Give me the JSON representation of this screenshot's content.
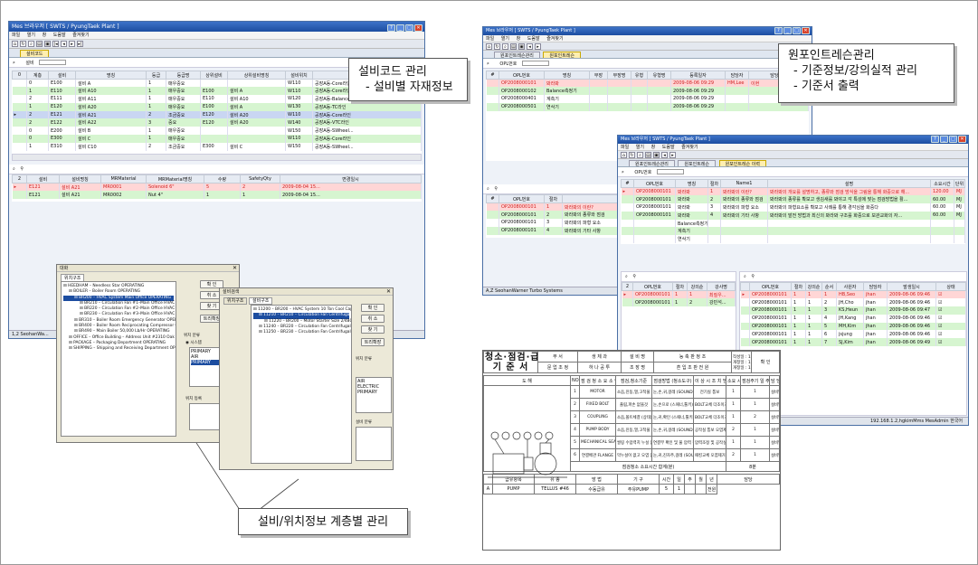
{
  "win1": {
    "title": "Mes 브라우저 [ SWTS / PyungTaek Plant ]",
    "menu": [
      "파일",
      "열기",
      "창",
      "도움말",
      "즐겨찾기"
    ],
    "tab": "설비코드",
    "search_label": "설비",
    "columns": [
      "0",
      "계층",
      "설비",
      "명칭",
      "등급",
      "등급명",
      "상위설비",
      "상위설비명칭",
      "설비위치",
      "위치명칭"
    ],
    "rows": [
      [
        "",
        "0",
        "E100",
        "설비 A",
        "1",
        "매우중요",
        "",
        "",
        "W110",
        "공장A동-Core라인"
      ],
      [
        "",
        "1",
        "E110",
        "설비 A10",
        "1",
        "매우중요",
        "E100",
        "설비 A",
        "W110",
        "공장A동-Core라인"
      ],
      [
        "",
        "2",
        "E111",
        "설비 A11",
        "1",
        "매우중요",
        "E110",
        "설비 A10",
        "W120",
        "공장A동-Balance..."
      ],
      [
        "",
        "1",
        "E120",
        "설비 A20",
        "1",
        "매우중요",
        "E100",
        "설비 A",
        "W130",
        "공장A동-TC라인"
      ],
      [
        "▸",
        "2",
        "E121",
        "설비 A21",
        "2",
        "조금중요",
        "E120",
        "설비 A20",
        "W110",
        "공장A동-Core라인"
      ],
      [
        "",
        "2",
        "E122",
        "설비 A22",
        "3",
        "중요",
        "E120",
        "설비 A20",
        "W140",
        "공장A동-VTC라인"
      ],
      [
        "",
        "0",
        "E200",
        "설비 B",
        "1",
        "매우중요",
        "",
        "",
        "W150",
        "공장A동-SWheel..."
      ],
      [
        "",
        "0",
        "E300",
        "설비 C",
        "1",
        "매우중요",
        "",
        "",
        "W110",
        "공장A동-Core라인"
      ],
      [
        "",
        "1",
        "E310",
        "설비 C10",
        "2",
        "조금중요",
        "E300",
        "설비 C",
        "W150",
        "공장A동-SWheel..."
      ]
    ],
    "sub_columns": [
      "2",
      "설비",
      "설비명칭",
      "MRMaterial",
      "MRMaterial명칭",
      "수량",
      "SafetyQty",
      "변경일시"
    ],
    "sub_rows": [
      [
        "▸",
        "E121",
        "설비 A21",
        "MR0001",
        "Solenoid 6\"",
        "5",
        "2",
        "2009-08-04 15..."
      ],
      [
        "",
        "E121",
        "설비 A21",
        "MR0002",
        "Nut 4\"",
        "1",
        "1",
        "2009-08-04 15..."
      ]
    ],
    "status": "1,2  SeohanWa..."
  },
  "callout1": {
    "line1": "설비코드 관리",
    "line2": "- 설비별 자재정보"
  },
  "callout2": {
    "line1": "원포인트레슨관리",
    "line2": "- 기준정보/강의실적 관리",
    "line3": "- 기준서 출력"
  },
  "callout3": {
    "line1": "설비/위치정보 계층별 관리"
  },
  "dialog1": {
    "title": "대화",
    "tab_label": "위치구조",
    "tree": [
      "HEEDHAM – Needless Star OPERATING",
      "BOILER – Boiler Room OPERATING",
      "BR200 – HVAC System Main Office OPERATING",
      "BR210 – Circulation Fan #1–Main Office HVAC",
      "BR220 – Circulation Fan #2–Main Office HVAC",
      "BR230 – Circulation Fan #3–Main Office HVAC",
      "BR310 – Boiler Room Emergency Generator OPEF",
      "BR400 – Boiler Room Reciprocating Compressor C",
      "BR490 – Main Boiler 50,000 Lb/Hr OPERATING",
      "OFFICE – Office Building – Address Unit #2310 Oak St. Of",
      "PACKAGE – Packaging Department OPERATING",
      "SHIPPING – Shipping and Receiving Department OPEF"
    ],
    "buttons": [
      "확 인",
      "취 소",
      "찾 기",
      "트리확장"
    ],
    "section": "위치 분류",
    "radio": "시스템",
    "list": [
      "PRIMARY",
      "AIR",
      "PRIMARY"
    ],
    "section2": "위치 등록"
  },
  "dialog2": {
    "title": "설비검색",
    "tabs": [
      "위치구조",
      "설비구조"
    ],
    "tree": [
      "11200 – BR200 – HVAC System 10 Ton Cool Cap 450000 Btu",
      "11210 – BR210 – Circulation Fan Centrifugal 20,000 C",
      "11220 – BR200 – Motor Starter Size 2/480v/3p",
      "11240 – BR220 – Circulation Fan Centrifugal 20,000 C",
      "11250 – BR230 – Circulation Fan Centrifugal 20,000 C"
    ],
    "buttons": [
      "확 인",
      "취 소",
      "찾 기",
      "트리확장"
    ],
    "section": "위치 분류",
    "list": [
      "AIR",
      "ELECTRIC",
      "PRIMARY"
    ],
    "section2": "설비 분류"
  },
  "win2": {
    "title": "Mes 브라우저 [ SWTS / PyungTaek Plant ]",
    "menu": [
      "파일",
      "열기",
      "창",
      "도움말",
      "즐겨찾기"
    ],
    "tabs": [
      "원포인트레슨관리",
      "원포인트레슨"
    ],
    "search_label": "OPL번호",
    "columns": [
      "#",
      "OPL번호",
      "명칭",
      "부장",
      "부장명",
      "유형",
      "유형명",
      "등록일자",
      "담당자",
      "담당자명"
    ],
    "rows": [
      [
        "",
        "OP2008000101",
        "봐라봐",
        "",
        "",
        "",
        "",
        "2009-08-06 09:29",
        "HM,Lee",
        "이현"
      ],
      [
        "",
        "OP2008000102",
        "Balance측정기",
        "",
        "",
        "",
        "",
        "2009-08-06 09:29",
        "",
        ""
      ],
      [
        "",
        "OP2008000401",
        "계측기",
        "",
        "",
        "",
        "",
        "2009-08-06 09:29",
        "",
        ""
      ],
      [
        "",
        "OP2008000501",
        "연삭기",
        "",
        "",
        "",
        "",
        "2009-08-06 09:29",
        "",
        ""
      ]
    ],
    "sub_columns": [
      "#",
      "OPL번호",
      "절차",
      "명칭"
    ],
    "sub_rows": [
      [
        "",
        "OP2008000101",
        "1",
        "봐라봐의 이란?"
      ],
      [
        "",
        "OP2008000101",
        "2",
        "봐라봐의 종류와 점검"
      ],
      [
        "",
        "OP2008000101",
        "3",
        "봐라봐의 파형 요소"
      ],
      [
        "",
        "OP2008000101",
        "4",
        "봐라봐의 기타 사항"
      ]
    ],
    "status": "A,Z   SeohanWarner Turbo Systems"
  },
  "win3": {
    "title": "Mes 브라우저 [ SWTS / PyungTaek Plant ]",
    "menu": [
      "파일",
      "열기",
      "창",
      "도움말",
      "즐겨찾기"
    ],
    "tabs": [
      "원포인트레슨관리",
      "원포인트레슨",
      "원포인트레슨 이력"
    ],
    "search_label": "OPL번호",
    "columns": [
      "#",
      "OPL번호",
      "명칭",
      "절차",
      "Name1",
      "설명",
      "소요시간",
      "단위"
    ],
    "rows": [
      [
        "▸",
        "OP2008000101",
        "봐라봐",
        "1",
        "봐라봐의 이란?",
        "봐라봐의 개요를 설명하고, 종류와 점검 방식을 그림을 통해 화중으로 해...",
        "120.00",
        "MJ"
      ],
      [
        "",
        "OP2008000101",
        "봐라봐",
        "2",
        "봐라봐의 종류와 점검",
        "봐라봐의 종류를 확보고 생김새를 봐야고 각 특성에 맞는 점검방법을 활...",
        "60.00",
        "MJ"
      ],
      [
        "",
        "OP2008000101",
        "봐라봐",
        "3",
        "봐라봐의 파형 요소",
        "봐라봐의 파형요소를 확보고 사례를 통해 경각심을 화중다",
        "60.00",
        "MJ"
      ],
      [
        "",
        "OP2008000101",
        "봐라봐",
        "4",
        "봐라봐의 기타 사항",
        "봐라봐의 발전 방법과 최신의 봐라봐 구조를 화중으로 보관교화의 자...",
        "60.00",
        "MJ"
      ],
      [
        "",
        "",
        "Balance측정기",
        "",
        "",
        "",
        "",
        ""
      ],
      [
        "",
        "",
        "계측기",
        "",
        "",
        "",
        "",
        ""
      ],
      [
        "",
        "",
        "연삭기",
        "",
        "",
        "",
        "",
        ""
      ]
    ],
    "sub_columns": [
      "2",
      "OPL번호",
      "절차",
      "강의순",
      "강사명"
    ],
    "sub_rows": [
      [
        "▸",
        "OP2008000101",
        "1",
        "1",
        "최질우..."
      ],
      [
        "",
        "OP2008000101",
        "1",
        "2",
        "강민석..."
      ]
    ],
    "hist_columns": [
      "",
      "OPL번호",
      "절차",
      "강의순",
      "순서",
      "사원자",
      "담당자",
      "발생일시",
      "상태"
    ],
    "hist_rows": [
      [
        "▸",
        "OP2008000101",
        "1",
        "1",
        "1",
        "HB,Seo",
        "jhan",
        "2009-08-06 09:46",
        "☑"
      ],
      [
        "",
        "OP2008000101",
        "1",
        "1",
        "2",
        "JH,Cho",
        "jhan",
        "2009-08-06 09:46",
        "☑"
      ],
      [
        "",
        "OP2008000101",
        "1",
        "1",
        "3",
        "KS,Heun",
        "jhan",
        "2009-08-06 09:47",
        "☑"
      ],
      [
        "",
        "OP2008000101",
        "1",
        "1",
        "4",
        "JH,Kang",
        "jhan",
        "2009-08-06 09:46",
        "☑"
      ],
      [
        "",
        "OP2008000101",
        "1",
        "1",
        "5",
        "MH,Kim",
        "jhan",
        "2009-08-06 09:46",
        "☑"
      ],
      [
        "",
        "OP2008000101",
        "1",
        "1",
        "6",
        "jsjung",
        "jhan",
        "2009-08-06 09:46",
        "☑"
      ],
      [
        "",
        "OP2008000101",
        "1",
        "1",
        "7",
        "SJ,Kim",
        "jhan",
        "2009-08-06 09:49",
        "☑"
      ]
    ],
    "status_right": "192.168.1.2,hgkimMms    MesAdmin         한국어"
  },
  "doc": {
    "title1": "청소·점검·급유",
    "title2": "기 준 서",
    "hdr": [
      "부 서",
      "생 체 과",
      "설 비 명",
      "능 축 판 정 조",
      "작성일 : 1998.06.02",
      "개정일 : 1997.11.02",
      "개정일 : 1998.06.10",
      "확 인"
    ],
    "hdr2": [
      "문 업 조 정",
      "하 나 공 투",
      "조 장 명",
      "흔 입 조 판 전 원"
    ],
    "col_heads": [
      "도 해",
      "NO",
      "점 검 청 소 요 소 항 목",
      "점검,청소기준",
      "점검방법 (청소도구)",
      "이 상 시 조 치 방 법",
      "소요 시간",
      "점검주기 일 주 월 년",
      "담 당"
    ],
    "rows": [
      [
        "1",
        "MOTOR",
        "소음,진동,열,고착물 제거",
        "눈,손,귀,걸레 (SOUNDSCOPE,BRUCH)",
        "전기실 통보",
        "1",
        "1",
        "설비담당"
      ],
      [
        "2",
        "FIXED BOLT",
        "풀림,파손 없을것",
        "눈,손으로 (스패너,툴키)",
        "BOLT교체 더조이기",
        "1",
        "1",
        "설비담당"
      ],
      [
        "3",
        "COUPLING",
        "소음,볼트체결 (상태)점검",
        "눈,귀,확인 (스패너,툴키)",
        "BOLT교체 더조이기",
        "1",
        "2",
        "설비담당"
      ],
      [
        "4",
        "PUMP BODY",
        "소음,진동,열,고착물 없을것",
        "눈,손,귀,걸레 (SOUNDSCOPE,BRUCH)",
        "공작실 통보 오염제거",
        "2",
        "1",
        "설비담당"
      ],
      [
        "5",
        "MECHANICAL SEAL",
        "씰링 수압력치 누설 없을것",
        "연결부 확인 및 물 압력 확인",
        "압력조정 및 공작실 통보",
        "1",
        "1",
        "설비담당"
      ],
      [
        "6",
        "연결배관 FLANGE",
        "막누설이 없고 오염 없을것",
        "눈,귀,진자주,걸레 (SOUNDSCOPE,BRUCH)",
        "패킹교체 오염제거",
        "2",
        "1",
        "설비담당"
      ]
    ],
    "total": "점검청소 소요시간 합계(분)",
    "total_label": "8분",
    "oil_heads": [
      "급유항목",
      "유 종",
      "방 법",
      "기 구",
      "시간",
      "일",
      "주",
      "월",
      "년",
      "담당"
    ],
    "oil_row": [
      "A",
      "PUMP",
      "TELLUS #46",
      "수동급유",
      "주유PUMP",
      "5",
      "1",
      "",
      "",
      "전원"
    ]
  }
}
